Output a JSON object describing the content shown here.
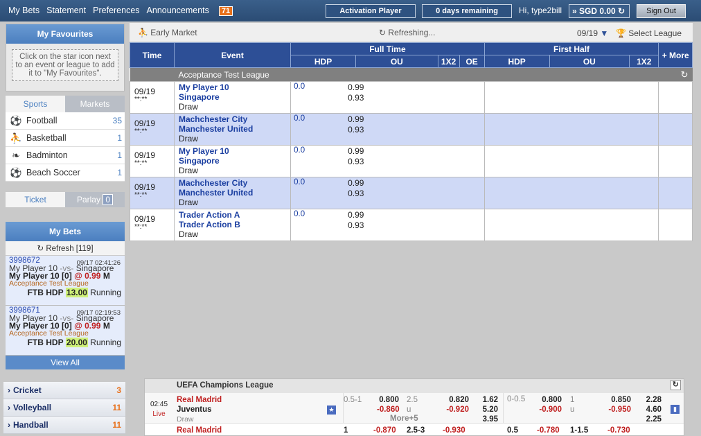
{
  "topbar": {
    "menu": [
      "My Bets",
      "Statement",
      "Preferences",
      "Announcements"
    ],
    "announcements_count": "71",
    "activation": "Activation Player",
    "days_remaining": "0 days remaining",
    "greeting": "Hi, type2bill",
    "balance": "SGD 0.00",
    "signout": "Sign Out"
  },
  "favourites": {
    "title": "My Favourites",
    "hint": "Click on the star icon next to an event or league to add it to \"My Favourites\"."
  },
  "sports_tabs": {
    "sports": "Sports",
    "markets": "Markets"
  },
  "sports": [
    {
      "name": "Football",
      "count": "35",
      "icon": "football-icon"
    },
    {
      "name": "Basketball",
      "count": "1",
      "icon": "basketball-icon"
    },
    {
      "name": "Badminton",
      "count": "1",
      "icon": "badminton-icon"
    },
    {
      "name": "Beach Soccer",
      "count": "1",
      "icon": "beach-soccer-icon"
    }
  ],
  "ticket_tabs": {
    "ticket": "Ticket",
    "parlay": "Parlay",
    "parlay_count": "0"
  },
  "mybets": {
    "title": "My Bets",
    "refresh": "Refresh [119]",
    "bets": [
      {
        "id": "3998672",
        "datetime": "09/17 02:41:26",
        "home": "My Player 10",
        "vs": "-vs-",
        "away": "Singapore",
        "selection": "My Player 10 [0]",
        "at": "@",
        "odds": "0.99",
        "type": "M",
        "league": "Acceptance Test League",
        "market": "FTB HDP",
        "stake": "13.00",
        "status": "Running"
      },
      {
        "id": "3998671",
        "datetime": "09/17 02:19:53",
        "home": "My Player 10",
        "vs": "-vs-",
        "away": "Singapore",
        "selection": "My Player 10 [0]",
        "at": "@",
        "odds": "0.99",
        "type": "M",
        "league": "Acceptance Test League",
        "market": "FTB HDP",
        "stake": "20.00",
        "status": "Running"
      }
    ],
    "view_all": "View All"
  },
  "market": {
    "title": "Early Market",
    "refreshing": "Refreshing...",
    "date": "09/19",
    "select_league": "Select League",
    "headers": {
      "time": "Time",
      "event": "Event",
      "full_time": "Full Time",
      "first_half": "First Half",
      "more": "+ More",
      "hdp": "HDP",
      "ou": "OU",
      "x12": "1X2",
      "oe": "OE"
    },
    "league": "Acceptance Test League",
    "events": [
      {
        "date": "09/19",
        "time": "**:**",
        "home": "My Player 10",
        "away": "Singapore",
        "draw": "Draw",
        "hdp": "0.0",
        "odd1": "0.99",
        "odd2": "0.93"
      },
      {
        "date": "09/19",
        "time": "**:**",
        "home": "Machchester City",
        "away": "Manchester United",
        "draw": "Draw",
        "hdp": "0.0",
        "odd1": "0.99",
        "odd2": "0.93"
      },
      {
        "date": "09/19",
        "time": "**:**",
        "home": "My Player 10",
        "away": "Singapore",
        "draw": "Draw",
        "hdp": "0.0",
        "odd1": "0.99",
        "odd2": "0.93"
      },
      {
        "date": "09/19",
        "time": "**:**",
        "home": "Machchester City",
        "away": "Manchester United",
        "draw": "Draw",
        "hdp": "0.0",
        "odd1": "0.99",
        "odd2": "0.93"
      },
      {
        "date": "09/19",
        "time": "**:**",
        "home": "Trader Action A",
        "away": "Trader Action B",
        "draw": "Draw",
        "hdp": "0.0",
        "odd1": "0.99",
        "odd2": "0.93"
      }
    ]
  },
  "other_sports": [
    {
      "name": "Cricket",
      "count": "3"
    },
    {
      "name": "Volleyball",
      "count": "11"
    },
    {
      "name": "Handball",
      "count": "11"
    }
  ],
  "live": {
    "league": "UEFA Champions League",
    "row1": {
      "time": "02:45",
      "live": "Live",
      "home": "Real Madrid",
      "away": "Juventus",
      "draw": "Draw",
      "ft_hdp_line": "0.5-1",
      "ft_hdp_home": "0.800",
      "ft_hdp_away": "-0.860",
      "ft_ou_line": "2.5",
      "ft_ou_u": "u",
      "ft_ou_over": "0.820",
      "ft_ou_under": "-0.920",
      "ft_1": "1.62",
      "ft_x": "5.20",
      "ft_2": "3.95",
      "more": "More+5",
      "fh_hdp_line": "0-0.5",
      "fh_hdp_home": "0.800",
      "fh_hdp_away": "-0.900",
      "fh_ou_line": "1",
      "fh_ou_u": "u",
      "fh_ou_over": "0.850",
      "fh_ou_under": "-0.950",
      "fh_1": "2.28",
      "fh_x": "4.60",
      "fh_2": "2.25"
    },
    "row2": {
      "home": "Real Madrid",
      "hdp_line": "1",
      "hdp_val": "-0.870",
      "ou_line": "2.5-3",
      "ou_val": "-0.930",
      "fh_line": "0.5",
      "fh_val": "-0.780",
      "fh_ou_line": "1-1.5",
      "fh_ou_val": "-0.730"
    }
  }
}
